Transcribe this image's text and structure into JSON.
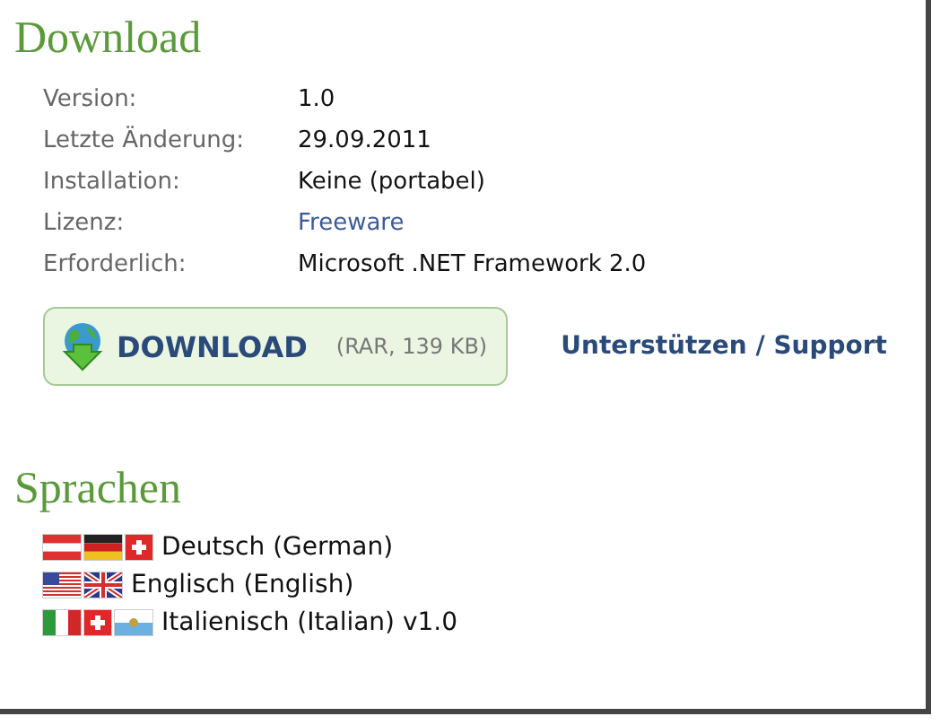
{
  "download_heading": "Download",
  "info": [
    {
      "label": "Version:",
      "value": "1.0",
      "kind": "text"
    },
    {
      "label": "Letzte Änderung:",
      "value": "29.09.2011",
      "kind": "text"
    },
    {
      "label": "Installation:",
      "value": "Keine (portabel)",
      "kind": "text"
    },
    {
      "label": "Lizenz:",
      "value": "Freeware",
      "kind": "link"
    },
    {
      "label": "Erforderlich:",
      "value": "Microsoft .NET Framework 2.0",
      "kind": "text"
    }
  ],
  "download_button": {
    "label": "DOWNLOAD",
    "size": "(RAR, 139 KB)"
  },
  "support_link": "Unterstützen / Support",
  "languages_heading": "Sprachen",
  "languages": [
    {
      "name": "Deutsch (German)",
      "flags": [
        {
          "kind": "austria"
        },
        {
          "kind": "germany"
        },
        {
          "kind": "switzerland"
        }
      ]
    },
    {
      "name": "Englisch (English)",
      "flags": [
        {
          "kind": "usa"
        },
        {
          "kind": "uk"
        }
      ]
    },
    {
      "name": "Italienisch (Italian) v1.0",
      "flags": [
        {
          "kind": "italy"
        },
        {
          "kind": "switzerland"
        },
        {
          "kind": "sanmarino"
        }
      ]
    }
  ]
}
